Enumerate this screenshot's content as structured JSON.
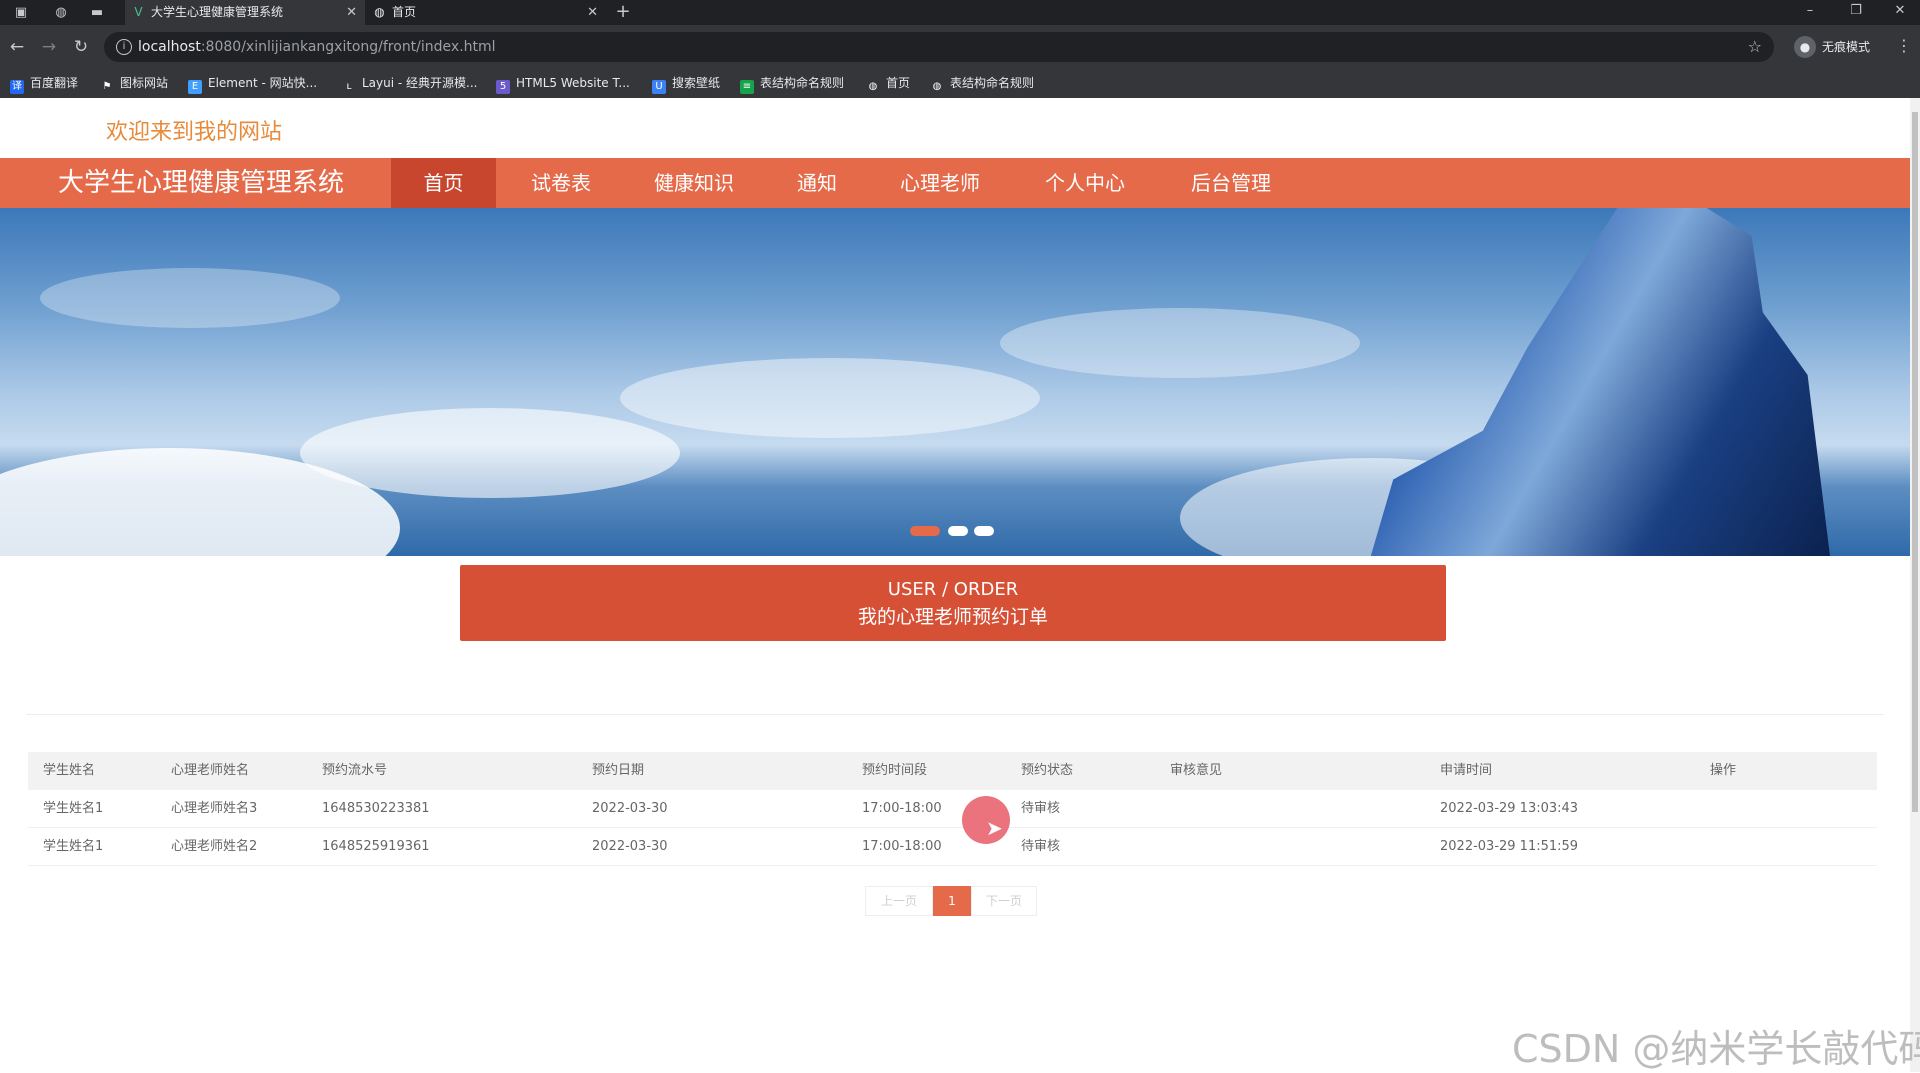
{
  "browser": {
    "tabs": [
      {
        "title": "大学生心理健康管理系统",
        "active": true
      },
      {
        "title": "首页",
        "active": false
      }
    ],
    "url_host": "localhost",
    "url_rest": ":8080/xinlijiankangxitong/front/index.html",
    "profile_label": "无痕模式",
    "bookmarks": [
      "百度翻译",
      "图标网站",
      "Element - 网站快...",
      "Layui - 经典开源模...",
      "HTML5 Website T...",
      "搜索壁纸",
      "表结构命名规则",
      "首页",
      "表结构命名规则"
    ]
  },
  "header": {
    "welcome": "欢迎来到我的网站",
    "brand": "大学生心理健康管理系统",
    "nav": [
      "首页",
      "试卷表",
      "健康知识",
      "通知",
      "心理老师",
      "个人中心",
      "后台管理"
    ],
    "active_nav": "首页"
  },
  "banner": {
    "slide_count": 3,
    "active_slide": 1
  },
  "section": {
    "title_en": "USER / ORDER",
    "title_cn": "我的心理老师预约订单"
  },
  "table": {
    "columns": [
      "学生姓名",
      "心理老师姓名",
      "预约流水号",
      "预约日期",
      "预约时间段",
      "预约状态",
      "审核意见",
      "申请时间",
      "操作"
    ],
    "rows": [
      [
        "学生姓名1",
        "心理老师姓名3",
        "1648530223381",
        "2022-03-30",
        "17:00-18:00",
        "待审核",
        "",
        "2022-03-29 13:03:43",
        ""
      ],
      [
        "学生姓名1",
        "心理老师姓名2",
        "1648525919361",
        "2022-03-30",
        "17:00-18:00",
        "待审核",
        "",
        "2022-03-29 11:51:59",
        ""
      ]
    ]
  },
  "pager": {
    "prev": "上一页",
    "current": "1",
    "next": "下一页"
  },
  "watermark": "CSDN @纳米学长敲代码",
  "colors": {
    "accent": "#e56a4a",
    "accent_dark": "#c9462e",
    "section_bg": "#d65036",
    "welcome": "#e78a3a"
  }
}
